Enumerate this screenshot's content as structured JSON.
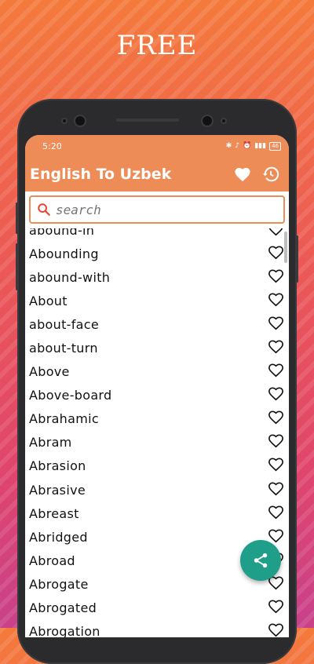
{
  "promo": {
    "title": "FREE"
  },
  "status": {
    "time": "5:20",
    "battery": "46"
  },
  "header": {
    "title": "English To Uzbek",
    "favorites_icon": "heart-icon",
    "history_icon": "history-icon"
  },
  "search": {
    "placeholder": "search"
  },
  "words": [
    "abound-in",
    "Abounding",
    "abound-with",
    "About",
    "about-face",
    "about-turn",
    "Above",
    "Above-board",
    "Abrahamic",
    "Abram",
    "Abrasion",
    "Abrasive",
    "Abreast",
    "Abridged",
    "Abroad",
    "Abrogate",
    "Abrogated",
    "Abrogation"
  ],
  "fab": {
    "icon": "share-icon"
  },
  "colors": {
    "accent": "#ee8c57",
    "fab": "#1f9e8a"
  }
}
